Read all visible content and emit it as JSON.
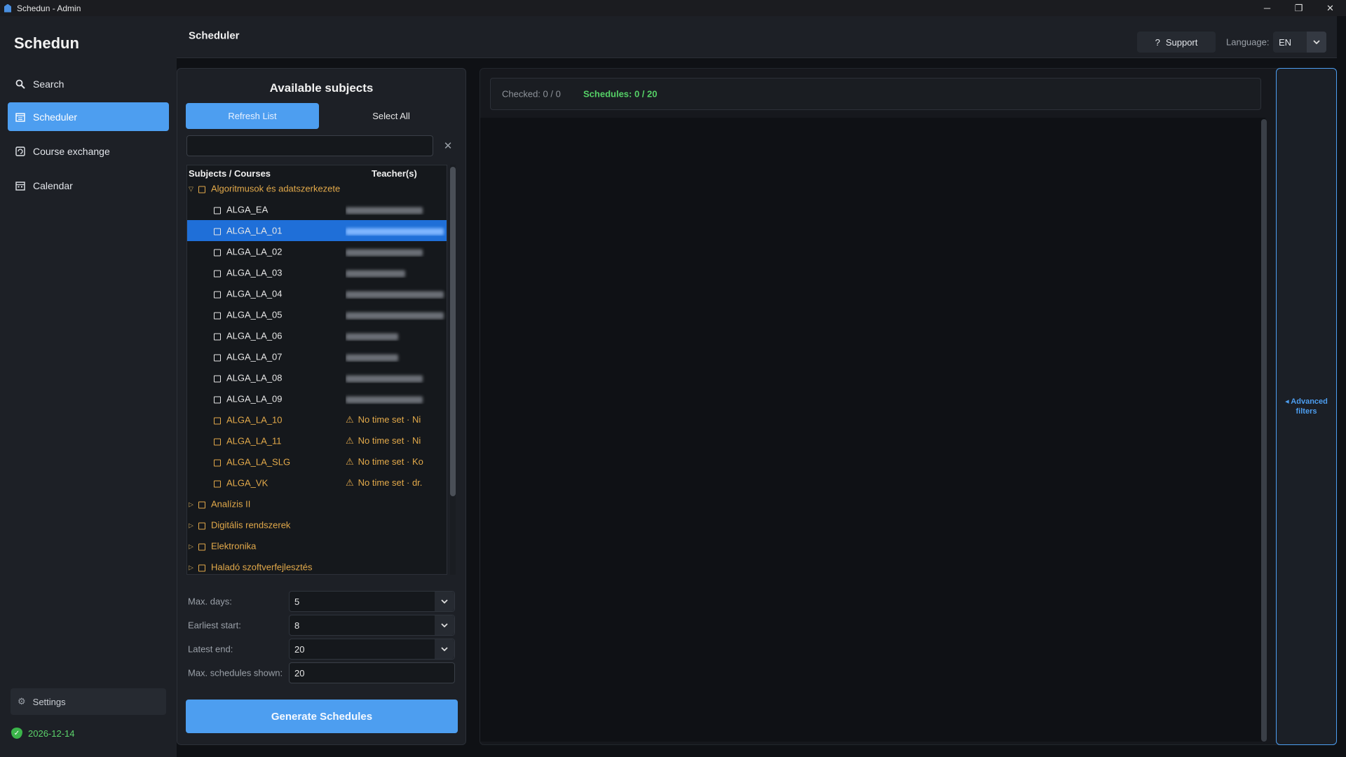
{
  "window": {
    "title": "Schedun - Admin",
    "controls": {
      "minimize": "─",
      "restore": "❐",
      "close": "✕"
    }
  },
  "sidebar": {
    "brand": "Schedun",
    "items": [
      {
        "label": "Search",
        "icon": "search-icon"
      },
      {
        "label": "Scheduler",
        "icon": "scheduler-icon",
        "active": true
      },
      {
        "label": "Course exchange",
        "icon": "exchange-icon"
      },
      {
        "label": "Calendar",
        "icon": "calendar-icon"
      }
    ],
    "settings_label": "Settings",
    "license_date": "2026-12-14"
  },
  "header": {
    "title": "Scheduler",
    "support_label": "Support",
    "language_label": "Language:",
    "language_value": "EN"
  },
  "subjects_panel": {
    "title": "Available subjects",
    "refresh_label": "Refresh List",
    "select_all_label": "Select All",
    "filter_value": "",
    "columns": [
      "Subjects / Courses",
      "Teacher(s)"
    ],
    "groups": [
      {
        "name": "Algoritmusok és adatszerkezete",
        "expanded": true,
        "courses": [
          {
            "code": "ALGA_EA",
            "teacher": ""
          },
          {
            "code": "ALGA_LA_01",
            "teacher": "",
            "selected": true
          },
          {
            "code": "ALGA_LA_02",
            "teacher": ""
          },
          {
            "code": "ALGA_LA_03",
            "teacher": ""
          },
          {
            "code": "ALGA_LA_04",
            "teacher": ""
          },
          {
            "code": "ALGA_LA_05",
            "teacher": ""
          },
          {
            "code": "ALGA_LA_06",
            "teacher": ""
          },
          {
            "code": "ALGA_LA_07",
            "teacher": ""
          },
          {
            "code": "ALGA_LA_08",
            "teacher": ""
          },
          {
            "code": "ALGA_LA_09",
            "teacher": ""
          },
          {
            "code": "ALGA_LA_10",
            "teacher": "No time set · Ni",
            "warning": true
          },
          {
            "code": "ALGA_LA_11",
            "teacher": "No time set · Ni",
            "warning": true
          },
          {
            "code": "ALGA_LA_SLG",
            "teacher": "No time set · Ko",
            "warning": true
          },
          {
            "code": "ALGA_VK",
            "teacher": "No time set · dr.",
            "warning": true
          }
        ]
      },
      {
        "name": "Analízis II",
        "expanded": false
      },
      {
        "name": "Digitális rendszerek",
        "expanded": false
      },
      {
        "name": "Elektronika",
        "expanded": false
      },
      {
        "name": "Haladó szoftverfejlesztés",
        "expanded": false
      }
    ],
    "options": [
      {
        "label": "Max. days:",
        "value": "5",
        "type": "select"
      },
      {
        "label": "Earliest start:",
        "value": "8",
        "type": "select"
      },
      {
        "label": "Latest end:",
        "value": "20",
        "type": "select"
      },
      {
        "label": "Max. schedules shown:",
        "value": "20",
        "type": "input"
      }
    ],
    "generate_label": "Generate Schedules"
  },
  "results": {
    "checked_text": "Checked: 0 / 0",
    "schedules_text": "Schedules: 0 / 20"
  },
  "advanced_filters": {
    "label_line1": "◂ Advanced",
    "label_line2": "filters"
  },
  "colors": {
    "accent": "#4d9ef0",
    "warning": "#e2a94a",
    "success": "#55d066",
    "background": "#0f1115",
    "panel": "#1d2026"
  }
}
